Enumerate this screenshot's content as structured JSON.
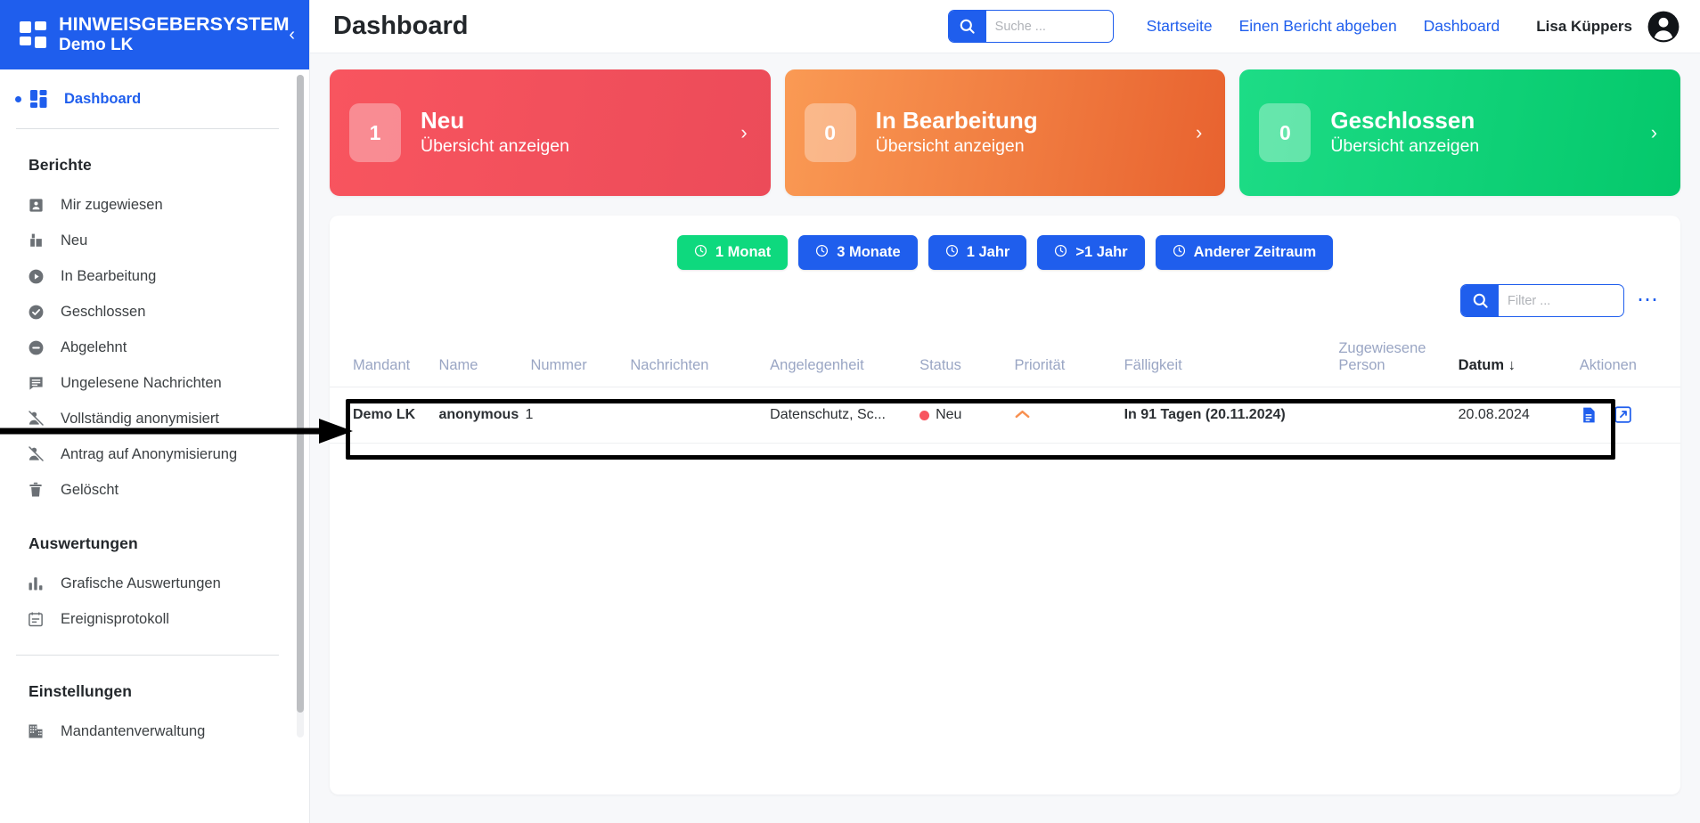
{
  "brand": {
    "line1": "HINWEISGEBERSYSTEM",
    "line2": "Demo LK",
    "collapse_icon": "chevron-left-icon"
  },
  "sidebar": {
    "dashboard": {
      "label": "Dashboard",
      "icon": "grid-icon"
    },
    "sections": [
      {
        "title": "Berichte",
        "items": [
          {
            "label": "Mir zugewiesen",
            "icon": "badge-person-icon"
          },
          {
            "label": "Neu",
            "icon": "inbox-out-icon"
          },
          {
            "label": "In Bearbeitung",
            "icon": "play-circle-icon"
          },
          {
            "label": "Geschlossen",
            "icon": "check-circle-icon"
          },
          {
            "label": "Abgelehnt",
            "icon": "minus-circle-icon"
          },
          {
            "label": "Ungelesene Nachrichten",
            "icon": "message-lines-icon"
          },
          {
            "label": "Vollständig anonymisiert",
            "icon": "person-slash-icon"
          },
          {
            "label": "Antrag auf Anonymisierung",
            "icon": "person-slash-icon"
          },
          {
            "label": "Gelöscht",
            "icon": "trash-icon"
          }
        ]
      },
      {
        "title": "Auswertungen",
        "items": [
          {
            "label": "Grafische Auswertungen",
            "icon": "bar-chart-icon"
          },
          {
            "label": "Ereignisprotokoll",
            "icon": "calendar-lines-icon"
          }
        ]
      },
      {
        "title": "Einstellungen",
        "items": [
          {
            "label": "Mandantenverwaltung",
            "icon": "building-icon"
          }
        ]
      }
    ]
  },
  "header": {
    "title": "Dashboard",
    "search": {
      "placeholder": "Suche ...",
      "value": "",
      "icon": "search-icon"
    },
    "links": [
      {
        "label": "Startseite"
      },
      {
        "label": "Einen Bericht abgeben"
      },
      {
        "label": "Dashboard"
      }
    ],
    "user": {
      "name": "Lisa Küppers",
      "avatar_icon": "user-circle-icon"
    }
  },
  "cards": [
    {
      "count": "1",
      "title": "Neu",
      "subtitle": "Übersicht anzeigen",
      "color": "#ec4b59",
      "arrow_icon": "chevron-right-icon"
    },
    {
      "count": "0",
      "title": "In Bearbeitung",
      "subtitle": "Übersicht anzeigen",
      "color": "#e8622f",
      "arrow_icon": "chevron-right-icon"
    },
    {
      "count": "0",
      "title": "Geschlossen",
      "subtitle": "Übersicht anzeigen",
      "color": "#04c86b",
      "arrow_icon": "chevron-right-icon"
    }
  ],
  "timefilters": [
    {
      "label": "1 Monat",
      "selected": true,
      "icon": "clock-icon"
    },
    {
      "label": "3 Monate",
      "selected": false,
      "icon": "clock-icon"
    },
    {
      "label": "1 Jahr",
      "selected": false,
      "icon": "clock-icon"
    },
    {
      "label": ">1 Jahr",
      "selected": false,
      "icon": "clock-icon"
    },
    {
      "label": "Anderer Zeitraum",
      "selected": false,
      "icon": "clock-icon"
    }
  ],
  "table_filter": {
    "placeholder": "Filter ...",
    "value": "",
    "icon": "search-icon",
    "more_icon": "more-horizontal-icon"
  },
  "table": {
    "columns": [
      {
        "label": "Mandant",
        "sorted": false
      },
      {
        "label": "Name",
        "sorted": false
      },
      {
        "label": "Nummer",
        "sorted": false
      },
      {
        "label": "Nachrichten",
        "sorted": false
      },
      {
        "label": "Angelegenheit",
        "sorted": false
      },
      {
        "label": "Status",
        "sorted": false
      },
      {
        "label": "Priorität",
        "sorted": false
      },
      {
        "label": "Fälligkeit",
        "sorted": false
      },
      {
        "label": "Zugewiesene Person",
        "sorted": false
      },
      {
        "label": "Datum",
        "sorted": true,
        "sort_dir": "↓"
      },
      {
        "label": "Aktionen",
        "sorted": false
      }
    ],
    "rows": [
      {
        "mandant": "Demo LK",
        "name": "anonymous",
        "nummer": "1",
        "nachrichten": "",
        "angelegenheit": "Datenschutz, Sc...",
        "status": "Neu",
        "status_color": "#f8555f",
        "prioritaet": "chevron-up-icon",
        "prioritaet_color": "#f89050",
        "faelligkeit": "In 91 Tagen (20.11.2024)",
        "zugewiesene_person": "",
        "datum": "20.08.2024",
        "actions": [
          "document-icon",
          "external-link-icon"
        ]
      }
    ]
  },
  "annotation": {
    "type": "arrow",
    "color": "#000000",
    "points_to": "table-row-highlight"
  },
  "colors": {
    "brand": "#1f5eed",
    "accent_green": "#0ed97e",
    "bg": "#f7f8fa"
  }
}
